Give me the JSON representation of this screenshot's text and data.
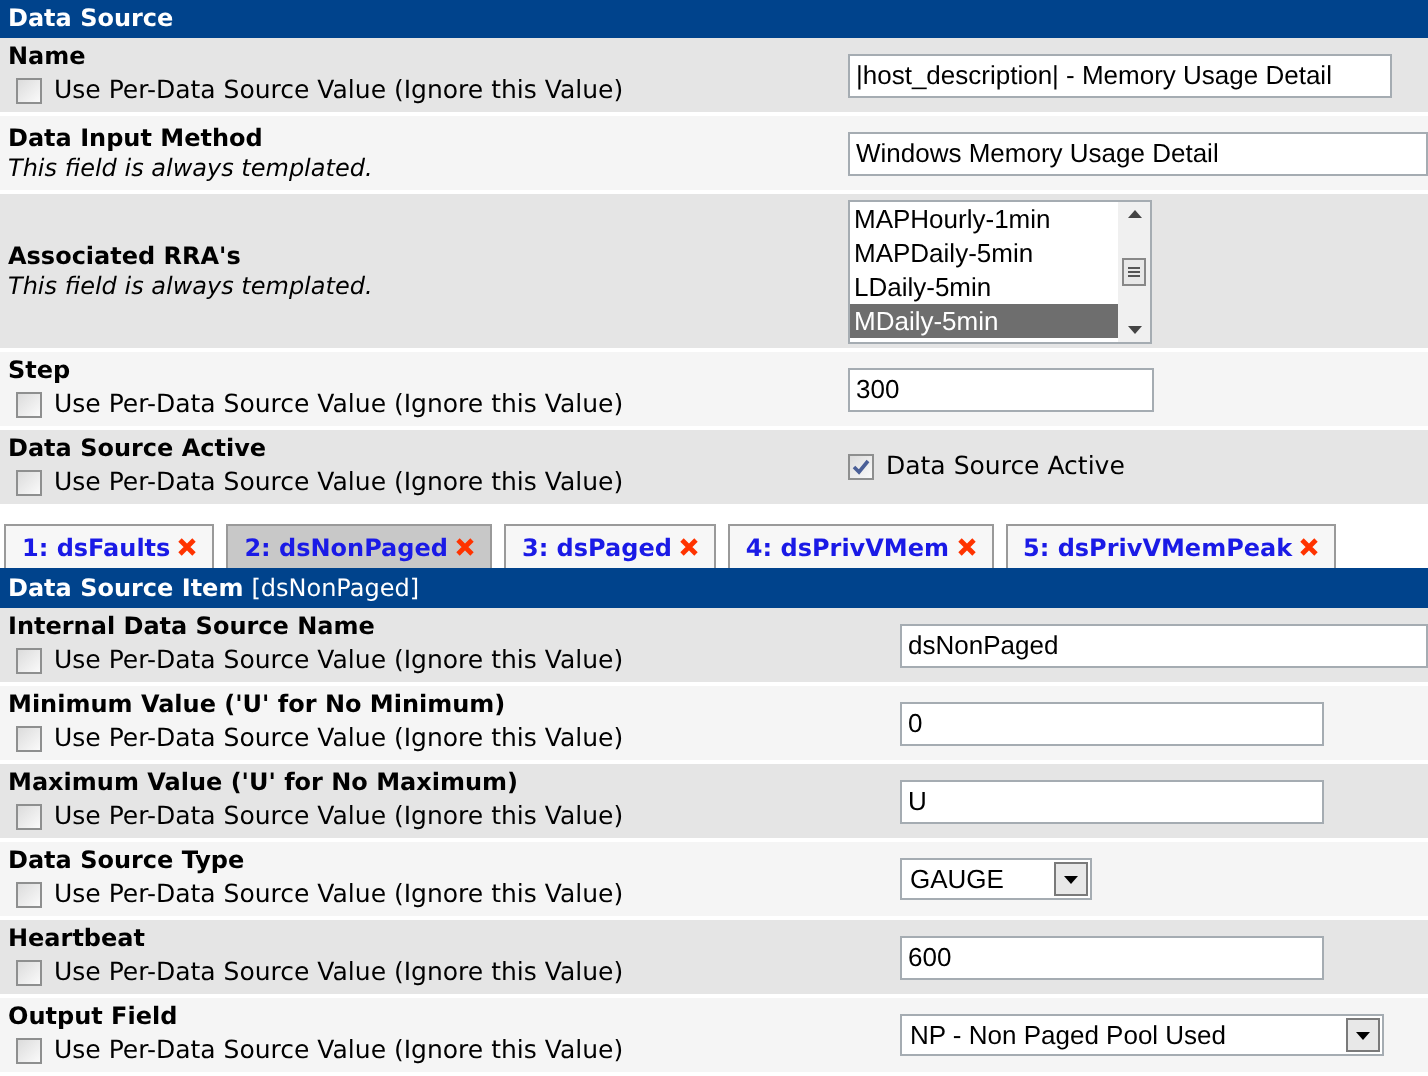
{
  "data_source": {
    "title": "Data Source",
    "rows": [
      {
        "label": "Name",
        "checkbox_label": "Use Per-Data Source Value (Ignore this Value)",
        "checked": false,
        "field": {
          "kind": "text",
          "value": "|host_description| - Memory Usage Detail"
        }
      },
      {
        "label": "Data Input Method",
        "note": "This field is always templated.",
        "field": {
          "kind": "text",
          "value": "Windows Memory Usage Detail"
        }
      },
      {
        "label": "Associated RRA's",
        "note": "This field is always templated.",
        "field": {
          "kind": "listbox",
          "options": [
            {
              "label": "MAPHourly-1min",
              "selected": false
            },
            {
              "label": "MAPDaily-5min",
              "selected": false
            },
            {
              "label": "LDaily-5min",
              "selected": false
            },
            {
              "label": "MDaily-5min",
              "selected": true
            }
          ]
        }
      },
      {
        "label": "Step",
        "checkbox_label": "Use Per-Data Source Value (Ignore this Value)",
        "checked": false,
        "field": {
          "kind": "text",
          "value": "300"
        }
      },
      {
        "label": "Data Source Active",
        "checkbox_label": "Use Per-Data Source Value (Ignore this Value)",
        "checked": false,
        "field": {
          "kind": "checkbox",
          "label": "Data Source Active",
          "checked": true
        }
      }
    ]
  },
  "tabs": [
    {
      "label": "1: dsFaults",
      "selected": false
    },
    {
      "label": "2: dsNonPaged",
      "selected": true
    },
    {
      "label": "3: dsPaged",
      "selected": false
    },
    {
      "label": "4: dsPrivVMem",
      "selected": false
    },
    {
      "label": "5: dsPrivVMemPeak",
      "selected": false
    }
  ],
  "data_source_item": {
    "title": "Data Source Item",
    "subtitle": "[dsNonPaged]",
    "rows": [
      {
        "label": "Internal Data Source Name",
        "checkbox_label": "Use Per-Data Source Value (Ignore this Value)",
        "checked": false,
        "field": {
          "kind": "text",
          "value": "dsNonPaged"
        }
      },
      {
        "label": "Minimum Value ('U' for No Minimum)",
        "checkbox_label": "Use Per-Data Source Value (Ignore this Value)",
        "checked": false,
        "field": {
          "kind": "text",
          "value": "0"
        }
      },
      {
        "label": "Maximum Value ('U' for No Maximum)",
        "checkbox_label": "Use Per-Data Source Value (Ignore this Value)",
        "checked": false,
        "field": {
          "kind": "text",
          "value": "U"
        }
      },
      {
        "label": "Data Source Type",
        "checkbox_label": "Use Per-Data Source Value (Ignore this Value)",
        "checked": false,
        "field": {
          "kind": "select",
          "value": "GAUGE"
        }
      },
      {
        "label": "Heartbeat",
        "checkbox_label": "Use Per-Data Source Value (Ignore this Value)",
        "checked": false,
        "field": {
          "kind": "text",
          "value": "600"
        }
      },
      {
        "label": "Output Field",
        "checkbox_label": "Use Per-Data Source Value (Ignore this Value)",
        "checked": false,
        "field": {
          "kind": "select",
          "value": "NP - Non Paged Pool Used"
        }
      }
    ]
  }
}
